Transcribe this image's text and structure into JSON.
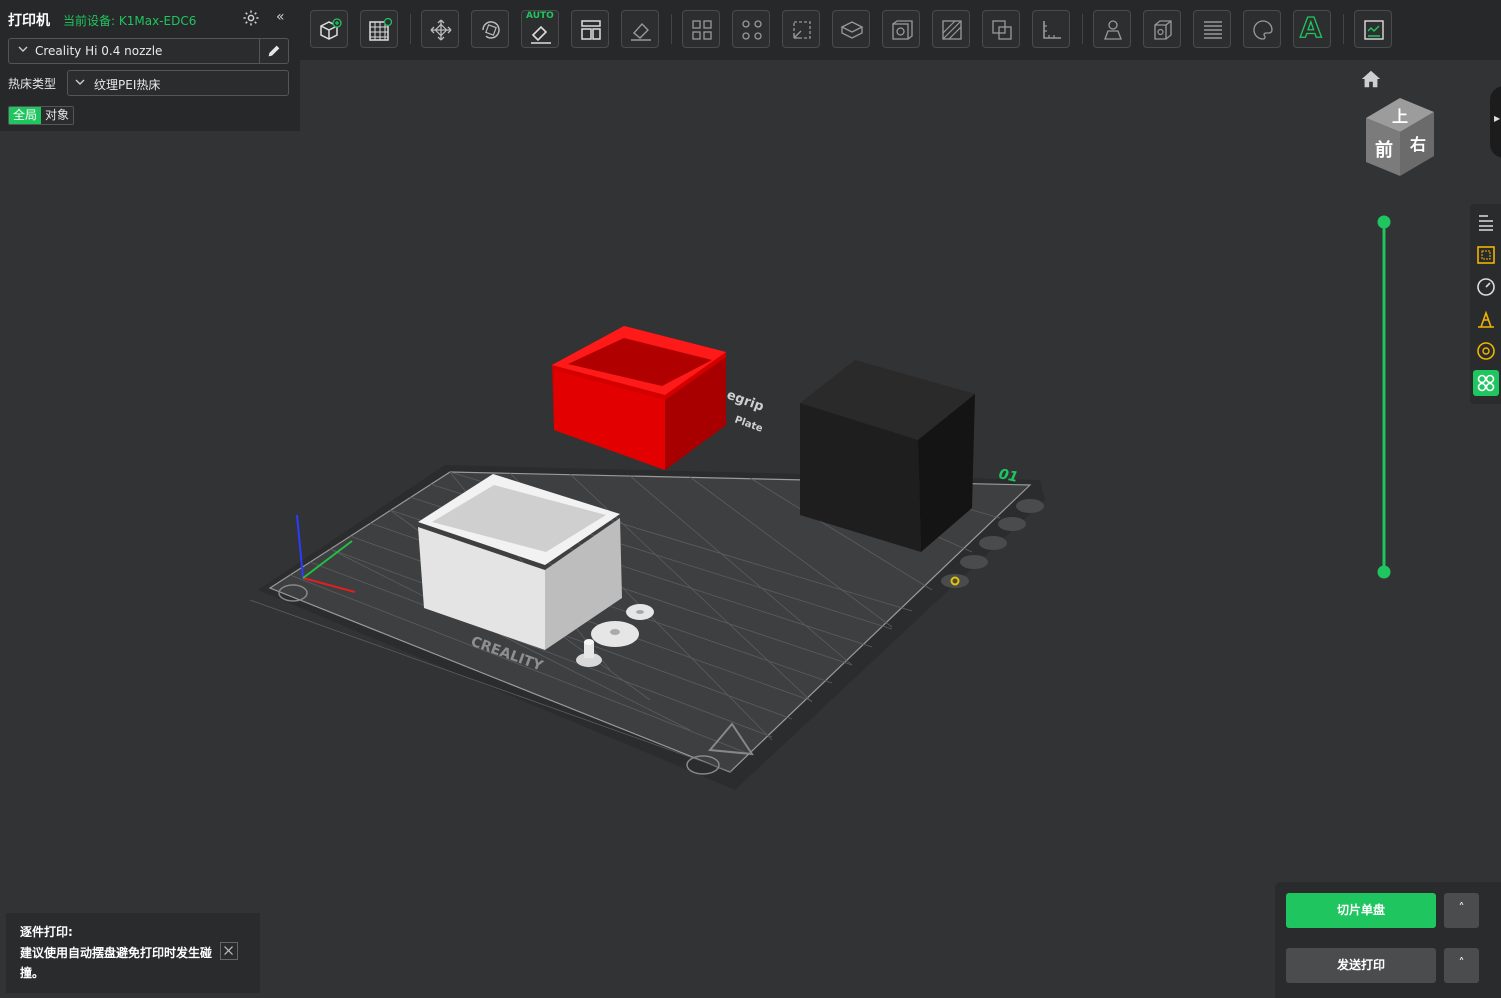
{
  "printer": {
    "title": "打印机",
    "device": "当前设备: K1Max-EDC6",
    "nozzle": "Creality Hi 0.4 nozzle",
    "bed_label": "热床类型",
    "bed_type": "纹理PEI热床",
    "scope_global": "全局",
    "scope_object": "对象",
    "collapse_glyph": "«"
  },
  "toolbar": {
    "auto_label": "AUTO",
    "text_tool_label": "A",
    "icons": [
      "add-object-icon",
      "plate-grid-icon",
      "move-icon",
      "rotate-icon",
      "auto-orient-icon",
      "arrange-icon",
      "lay-flat-icon",
      "split-objects-icon",
      "split-parts-icon",
      "scale-icon",
      "cut-icon",
      "shell-icon",
      "support-paint-icon",
      "boolean-icon",
      "measure-icon",
      "mesh-repair-icon",
      "hollow-icon",
      "layer-icon",
      "color-paint-icon",
      "text-icon",
      "assembly-view-icon"
    ]
  },
  "viewport": {
    "plate_number": "01",
    "brand_text": "CREALITY",
    "plate_text_1": "egrip",
    "plate_text_2": "Plate",
    "cube_top": "上",
    "cube_front": "前",
    "cube_right": "右",
    "colors": {
      "red_box": "#e00000",
      "black_box": "#1c1c1c",
      "white_box": "#e4e4e4",
      "accent": "#1fc55e"
    }
  },
  "notice": {
    "title": "逐件打印:",
    "message": "建议使用自动摆盘避免打印时发生碰撞。"
  },
  "actions": {
    "slice_label": "切片单盘",
    "send_label": "发送打印",
    "caret": "˄"
  }
}
